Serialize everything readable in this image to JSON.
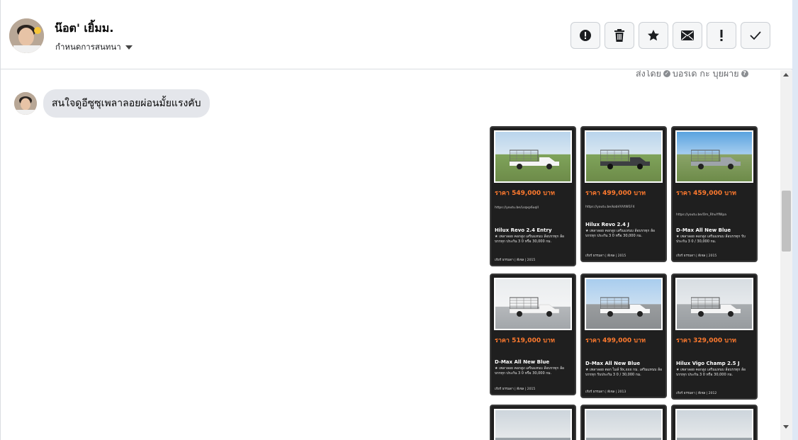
{
  "header": {
    "name": "น๊อต' เยิ้มม.",
    "assign_label": "กำหนดการสนทนา",
    "actions": [
      {
        "icon": "alert-icon"
      },
      {
        "icon": "trash-icon"
      },
      {
        "icon": "star-icon"
      },
      {
        "icon": "mail-icon"
      },
      {
        "icon": "exclamation-icon"
      },
      {
        "icon": "check-icon"
      }
    ]
  },
  "conversation": {
    "sent_by": "ส่งโดย",
    "sent_by_name": "บอรเด กะ บุยผาย",
    "message": "สนใจดูอีซูซุเพลาลอยผ่อนมั้ยแรงคับ"
  },
  "cards": [
    {
      "price": "ราคา 549,000 บาท",
      "model": "Hilux Revo 2.4 Entry",
      "link": "https://youtu.be/Lsqxp6uqlI",
      "desc": "★ เพลาลอย คอกสูง เสริมแหนบ ล้อบรรทุก ล้อบรรทุก ประกัน 3 0 หรือ 30,000 กม.",
      "foot": "เกียร์ ธรรมดา | ดีเซล | 2015"
    },
    {
      "price": "ราคา 499,000 บาท",
      "model": "Hilux Revo 2.4 J",
      "link": "https://youtu.be/kobVVVtW1F4",
      "desc": "★ เพลาลอย คอกสูง เสริมแหนบ ล้อบรรทุก ล้อบรรทุก ประกัน 3 0 หรือ 30,000 กม.",
      "foot": "เกียร์ ธรรมดา | ดีเซล | 2015"
    },
    {
      "price": "ราคา 459,000 บาท",
      "model": "D-Max All New Blue",
      "link": "https://youtu.be/Om_RhuYfWpa",
      "desc": "★ เพลาลอย คอกสูง เสริมแหนบ ล้อบรรทุก รับประกัน 3 0 / 30,000 กม.",
      "foot": "เกียร์ ธรรมดา | ดีเซล | 2015"
    },
    {
      "price": "ราคา 519,000 บาท",
      "model": "D-Max All New Blue",
      "link": "",
      "desc": "★ เพลาลอย คอกสูง เสริมแหนบ ล้อบรรทุก ล้อบรรทุก ประกัน 3 0 หรือ 30,000 กม.",
      "foot": "เกียร์ ธรรมดา | ดีเซล | 2015"
    },
    {
      "price": "ราคา 499,000 บาท",
      "model": "D-Max All New Blue",
      "link": "",
      "desc": "★ เพลาลอย ตอก ไมล์ 9x,xxx กม. เสริมแหนบ ล้อบรรทุก รับประกัน 3 0 / 30,000 กม.",
      "foot": "เกียร์ ธรรมดา | ดีเซล | 2013"
    },
    {
      "price": "ราคา 329,000 บาท",
      "model": "Hilux Vigo Champ 2.5 J",
      "link": "",
      "desc": "★ เพลาลอย คอกสูง เสริมแหนบ ล้อบรรทุก ล้อบรรทุก ประกัน 3 0 หรือ 30,000 กม.",
      "foot": "เกียร์ ธรรมดา | ดีเซล | 2012"
    }
  ]
}
